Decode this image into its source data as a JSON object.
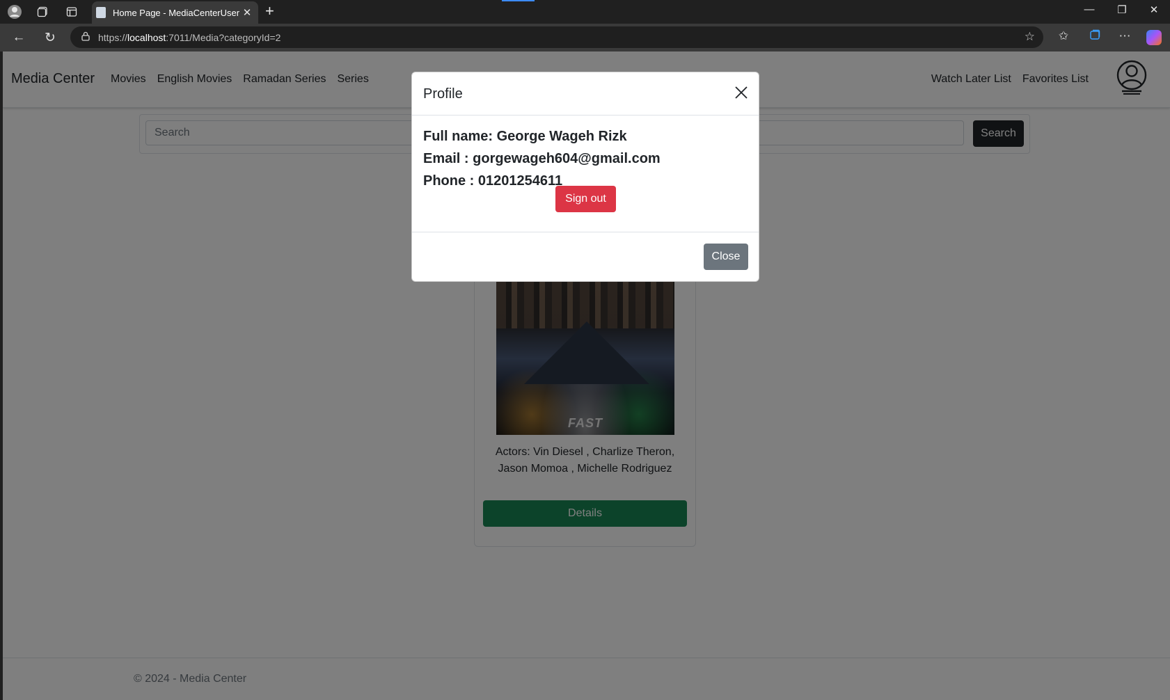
{
  "browser": {
    "tab_title": "Home Page - MediaCenterUser",
    "url_prefix": "https://",
    "url_host": "localhost",
    "url_rest": ":7011/Media?categoryId=2"
  },
  "navbar": {
    "brand": "Media Center",
    "links": [
      "Movies",
      "English Movies",
      "Ramadan Series",
      "Series"
    ],
    "right_links": [
      "Watch Later List",
      "Favorites List"
    ]
  },
  "search": {
    "placeholder": "Search",
    "button": "Search"
  },
  "card": {
    "poster_text": "FAST",
    "actors": "Actors: Vin Diesel , Charlize Theron, Jason Momoa , Michelle Rodriguez",
    "details_button": "Details"
  },
  "footer": {
    "text": "© 2024 - Media Center"
  },
  "modal": {
    "title": "Profile",
    "full_name": "Full name: George Wageh Rizk",
    "email": "Email : gorgewageh604@gmail.com",
    "phone": "Phone : 01201254611",
    "signout": "Sign out",
    "close": "Close"
  },
  "colors": {
    "success": "#198754",
    "danger": "#dc3545",
    "secondary": "#6c757d",
    "dark": "#212529"
  }
}
